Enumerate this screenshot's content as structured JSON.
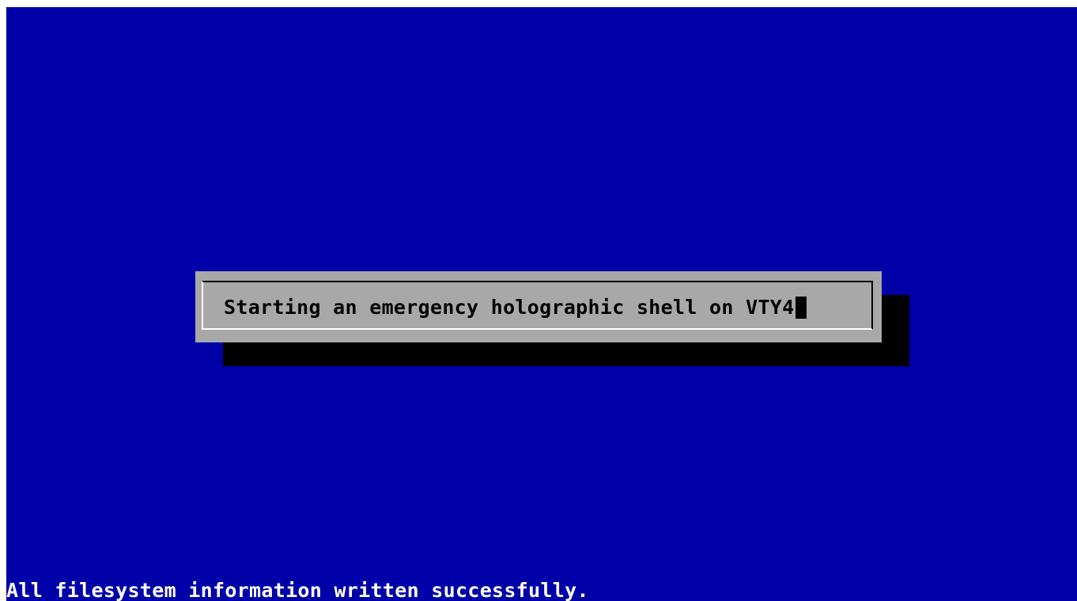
{
  "dialog": {
    "message": "Starting an emergency holographic shell on VTY4"
  },
  "console": {
    "status_line": "All filesystem information written successfully."
  },
  "colors": {
    "background": "#0000a8",
    "dialog": "#a8a8a8",
    "shadow": "#000000",
    "console_text": "#ffffff"
  }
}
